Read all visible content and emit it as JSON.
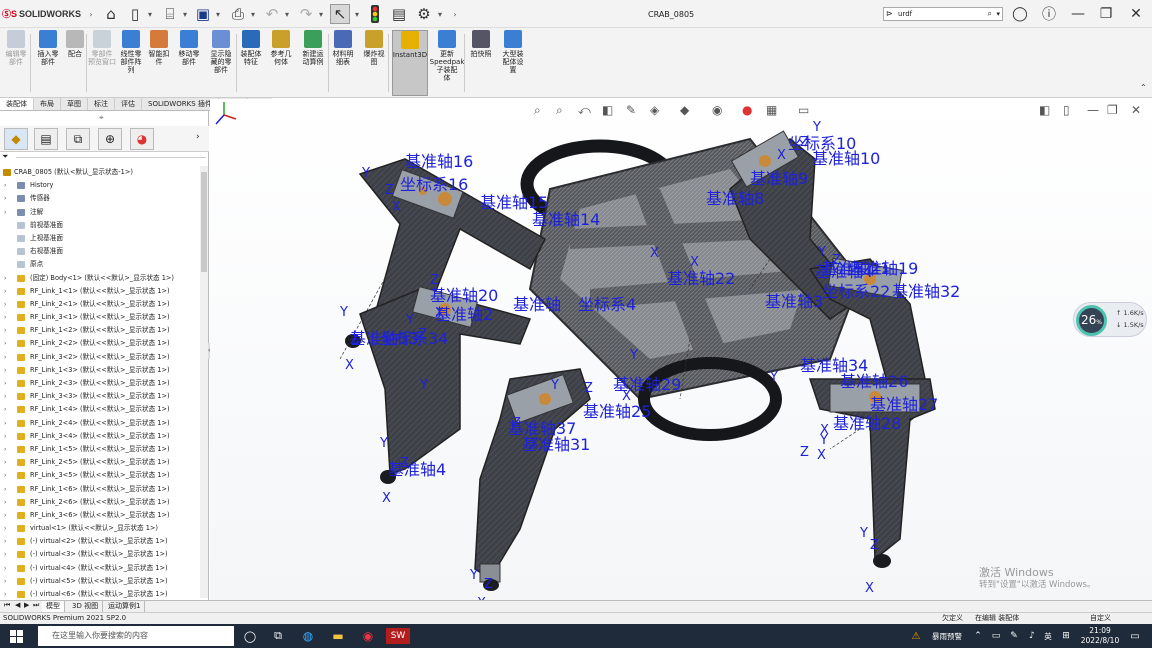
{
  "app": {
    "logo_text": "SOLIDWORKS",
    "doc_title": "CRAB_0805",
    "search_value": "urdf"
  },
  "ribbon": {
    "buttons": [
      {
        "label": "编辑零\n部件",
        "disabled": true
      },
      {
        "label": "插入零\n部件",
        "disabled": false
      },
      {
        "label": "配合",
        "disabled": false
      },
      {
        "label": "零部件\n预览窗口",
        "disabled": true
      },
      {
        "label": "线性零\n部件阵\n列",
        "disabled": false
      },
      {
        "label": "智能扣\n件",
        "disabled": false
      },
      {
        "label": "移动零\n部件",
        "disabled": false
      },
      {
        "label": "显示隐\n藏的零\n部件",
        "disabled": false
      },
      {
        "label": "装配体\n特征",
        "disabled": false
      },
      {
        "label": "参考几\n何体",
        "disabled": false
      },
      {
        "label": "新建运\n动算例",
        "disabled": false
      },
      {
        "label": "材料明\n细表",
        "disabled": false
      },
      {
        "label": "爆炸视\n图",
        "disabled": false
      },
      {
        "label": "Instant3D",
        "disabled": false
      },
      {
        "label": "更新\nSpeedpak\n子装配\n体",
        "disabled": false
      },
      {
        "label": "拍快照",
        "disabled": false
      },
      {
        "label": "大型装\n配体设\n置",
        "disabled": false
      }
    ]
  },
  "tabs": [
    "装配体",
    "布局",
    "草图",
    "标注",
    "评估",
    "SOLIDWORKS 插件",
    "MBD"
  ],
  "tree": {
    "root": "CRAB_0805  (默认<默认_显示状态-1>)",
    "items": [
      "History",
      "传感器",
      "注解",
      "前视基准面",
      "上视基准面",
      "右视基准面",
      "原点",
      "(固定) Body<1> (默认<<默认>_显示状态 1>)",
      "RF_Link_1<1> (默认<<默认>_显示状态 1>)",
      "RF_Link_2<1> (默认<<默认>_显示状态 1>)",
      "RF_Link_3<1> (默认<<默认>_显示状态 1>)",
      "RF_Link_1<2> (默认<<默认>_显示状态 1>)",
      "RF_Link_2<2> (默认<<默认>_显示状态 1>)",
      "RF_Link_3<2> (默认<<默认>_显示状态 1>)",
      "RF_Link_1<3> (默认<<默认>_显示状态 1>)",
      "RF_Link_2<3> (默认<<默认>_显示状态 1>)",
      "RF_Link_3<3> (默认<<默认>_显示状态 1>)",
      "RF_Link_1<4> (默认<<默认>_显示状态 1>)",
      "RF_Link_2<4> (默认<<默认>_显示状态 1>)",
      "RF_Link_3<4> (默认<<默认>_显示状态 1>)",
      "RF_Link_1<5> (默认<<默认>_显示状态 1>)",
      "RF_Link_2<5> (默认<<默认>_显示状态 1>)",
      "RF_Link_3<5> (默认<<默认>_显示状态 1>)",
      "RF_Link_1<6> (默认<<默认>_显示状态 1>)",
      "RF_Link_2<6> (默认<<默认>_显示状态 1>)",
      "RF_Link_3<6> (默认<<默认>_显示状态 1>)",
      "virtual<1> (默认<<默认>_显示状态 1>)",
      "(-) virtual<2> (默认<<默认>_显示状态 1>)",
      "(-) virtual<3> (默认<<默认>_显示状态 1>)",
      "(-) virtual<4> (默认<<默认>_显示状态 1>)",
      "(-) virtual<5> (默认<<默认>_显示状态 1>)",
      "(-) virtual<6> (默认<<默认>_显示状态 1>)"
    ]
  },
  "bottom_tabs": [
    "模型",
    "3D 视图",
    "运动算例1"
  ],
  "status": {
    "product": "SOLIDWORKS Premium 2021 SP2.0",
    "undefined": "欠定义",
    "editing": "在编辑 装配体",
    "custom": "自定义"
  },
  "taskbar": {
    "search_placeholder": "在这里输入你要搜索的内容",
    "weather": "暴雨预警",
    "ime": "英",
    "time": "21:09",
    "date": "2022/8/10"
  },
  "speedo": {
    "percent": "26",
    "percent_unit": "%",
    "up": "1.6",
    "down": "1.5",
    "unit": "K/s"
  },
  "watermark": {
    "line1": "激活 Windows",
    "line2": "转到\"设置\"以激活 Windows。"
  },
  "viewport": {
    "labels": [
      "基准轴16",
      "坐标系16",
      "基准轴15",
      "基准轴14",
      "坐标系10",
      "基准轴10",
      "基准轴9",
      "基准轴8",
      "基准轴21",
      "基准轴22",
      "坐标系22",
      "基准轴20",
      "基准轴2",
      "基准轴",
      "坐标系4",
      "基准轴4",
      "基准轴3",
      "基准轴19",
      "基准轴32",
      "基准轴33",
      "坐标系34",
      "基准轴34",
      "基准轴26",
      "基准轴27",
      "基准轴28",
      "基准轴29",
      "基准轴25",
      "基准轴37",
      "基准轴31",
      "基准轴4"
    ],
    "axes": [
      "Y",
      "Z",
      "X",
      "Y",
      "Z",
      "X",
      "Y",
      "Z",
      "X",
      "Y",
      "Z",
      "X",
      "Y",
      "Z",
      "X",
      "Y",
      "Z",
      "X",
      "Y",
      "Z",
      "X",
      "Y",
      "Z",
      "X",
      "Y",
      "Z",
      "X",
      "Y",
      "Z",
      "X",
      "Y",
      "Z",
      "X",
      "Y",
      "Z",
      "X",
      "Y",
      "X"
    ]
  }
}
